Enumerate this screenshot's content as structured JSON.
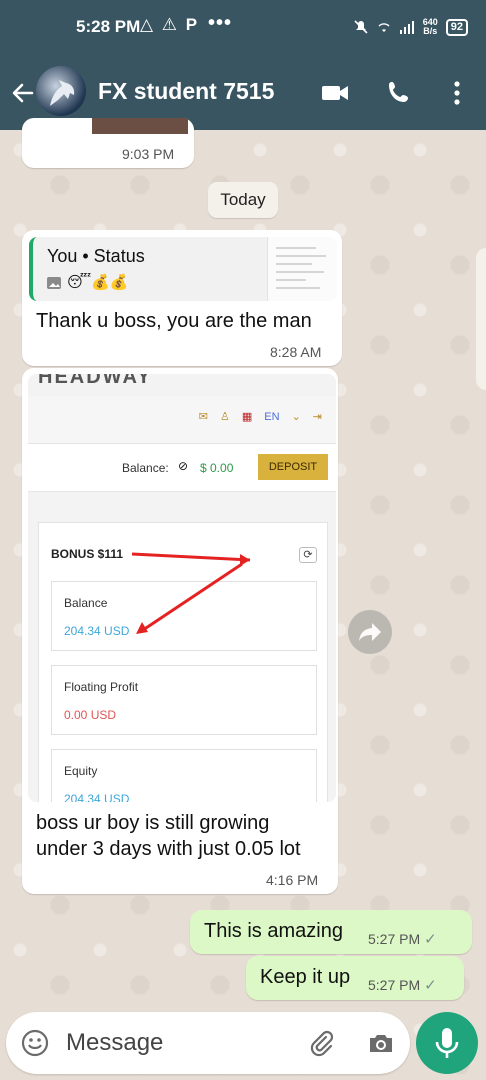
{
  "status_bar": {
    "time": "5:28 PM",
    "left_icons": "△ ⚠ P",
    "dots": "•••",
    "speed_top": "640",
    "speed_bottom": "B/s",
    "battery": "92"
  },
  "header": {
    "contact_name": "FX student 7515",
    "icons": [
      "back-icon",
      "avatar",
      "video-call-icon",
      "phone-icon",
      "more-options-icon"
    ]
  },
  "colors": {
    "header_bg": "#3a5562",
    "incoming_bubble": "#ffffff",
    "outgoing_bubble": "#dcf8c6",
    "accent_green": "#1fa47c",
    "deposit_gold": "#d8b23c",
    "annotation_red": "#e52222"
  },
  "chat": {
    "prev_message_time": "9:03 PM",
    "date_separator": "Today",
    "reply_message": {
      "quote_author": "You • Status",
      "quote_preview": "😴💰💰",
      "text": "Thank u boss, you are the man",
      "time": "8:28 AM"
    },
    "image_message": {
      "embedded_screenshot": {
        "logo": "HEADWAY",
        "language": "EN",
        "balance_label": "Balance:",
        "balance_amount": "$ 0.00",
        "deposit_button": "DEPOSIT",
        "bonus_label": "BONUS $111",
        "refresh_glyph": "⟳",
        "rows": [
          {
            "label": "Balance",
            "value": "204.34 USD",
            "color": "#3fa7d6"
          },
          {
            "label": "Floating Profit",
            "value": "0.00 USD",
            "color": "#e05555"
          },
          {
            "label": "Equity",
            "value": "204.34 USD",
            "color": "#3fa7d6"
          }
        ]
      },
      "caption_line1": "boss ur boy is still growing",
      "caption_line2": "under 3 days with just 0.05 lot",
      "time": "4:16 PM"
    },
    "outgoing": [
      {
        "text": "This is amazing",
        "time": "5:27 PM"
      },
      {
        "text": "Keep it up",
        "time": "5:27 PM"
      }
    ]
  },
  "input": {
    "placeholder": "Message",
    "icons": [
      "emoji-icon",
      "attach-icon",
      "camera-icon",
      "mic-icon"
    ]
  }
}
